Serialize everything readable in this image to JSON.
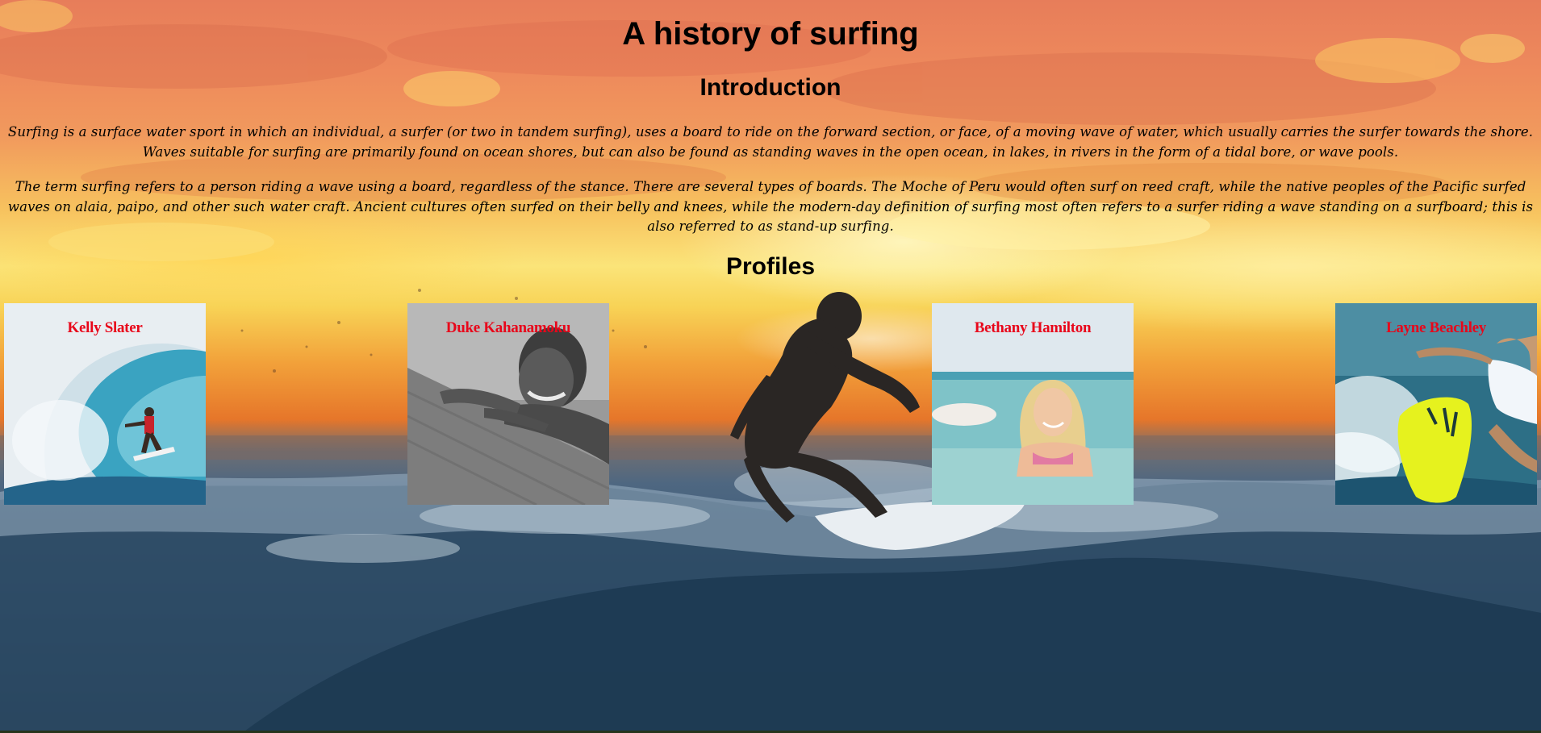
{
  "page": {
    "title": "A history of surfing",
    "title_color": "#000000"
  },
  "introduction": {
    "heading": "Introduction",
    "paragraphs": [
      "Surfing is a surface water sport in which an individual, a surfer (or two in tandem surfing), uses a board to ride on the forward section, or face, of a moving wave of water, which usually carries the surfer towards the shore. Waves suitable for surfing are primarily found on ocean shores, but can also be found as standing waves in the open ocean, in lakes, in rivers in the form of a tidal bore, or wave pools.",
      "The term surfing refers to a person riding a wave using a board, regardless of the stance. There are several types of boards. The Moche of Peru would often surf on reed craft, while the native peoples of the Pacific surfed waves on alaia, paipo, and other such water craft. Ancient cultures often surfed on their belly and knees, while the modern-day definition of surfing most often refers to a surfer riding a wave standing on a surfboard; this is also referred to as stand-up surfing."
    ]
  },
  "profiles": {
    "heading": "Profiles",
    "name_color": "#e8061a",
    "items": [
      {
        "name": "Kelly Slater",
        "photo": "surfer-in-barrel-photo"
      },
      {
        "name": "Duke Kahanamoku",
        "photo": "black-and-white-portrait-photo"
      },
      {
        "name": "Bethany Hamilton",
        "photo": "surfer-in-water-photo"
      },
      {
        "name": "Layne Beachley",
        "photo": "surfer-on-yellow-board-photo"
      }
    ]
  },
  "background": {
    "image": "sunset-surfer-wave-photo",
    "sky_color": "#ee8a5c",
    "sun_color": "#fbe479",
    "ocean_color": "#2f4f6b"
  }
}
